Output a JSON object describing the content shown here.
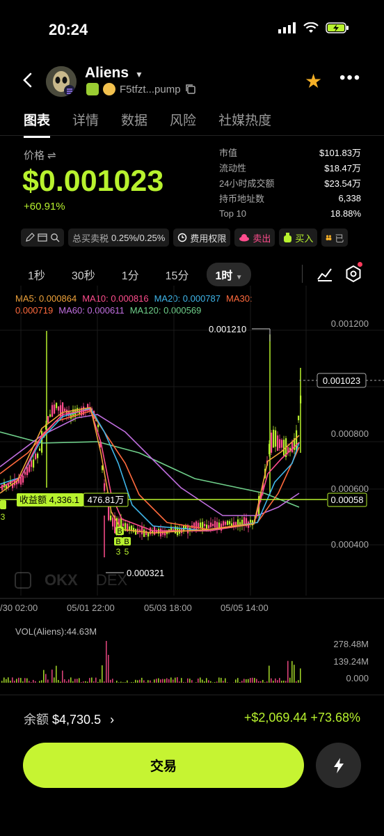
{
  "status_bar": {
    "time": "20:24"
  },
  "header": {
    "token_name": "Aliens",
    "address": "F5tfzt...pump"
  },
  "tabs": [
    {
      "label": "图表",
      "active": true
    },
    {
      "label": "详情",
      "active": false
    },
    {
      "label": "数据",
      "active": false
    },
    {
      "label": "风险",
      "active": false
    },
    {
      "label": "社媒热度",
      "active": false
    }
  ],
  "price": {
    "label": "价格 ⇌",
    "value": "$0.001023",
    "change": "+60.91%"
  },
  "stats": [
    {
      "key": "市值",
      "value": "$101.83万"
    },
    {
      "key": "流动性",
      "value": "$18.47万"
    },
    {
      "key": "24小时成交额",
      "value": "$23.54万"
    },
    {
      "key": "持币地址数",
      "value": "6,338"
    },
    {
      "key": "Top 10",
      "value": "18.88%"
    }
  ],
  "chips": {
    "tax_label": "总买卖税",
    "tax_value": "0.25%/0.25%",
    "fee_label": "费用权限",
    "sell_label": "卖出",
    "buy_label": "买入",
    "partial_label": "已"
  },
  "intervals": [
    {
      "label": "1秒",
      "active": false
    },
    {
      "label": "30秒",
      "active": false
    },
    {
      "label": "1分",
      "active": false
    },
    {
      "label": "15分",
      "active": false
    },
    {
      "label": "1时",
      "active": true
    }
  ],
  "ma_legend": [
    {
      "text": "MA5: 0.000864",
      "color": "#f0a33a"
    },
    {
      "text": "MA10: 0.000816",
      "color": "#ff4d8d"
    },
    {
      "text": "MA20: 0.000787",
      "color": "#3fb6ea"
    },
    {
      "text": "MA30: 0.000719",
      "color": "#ff6a3d"
    },
    {
      "text": "MA60: 0.000611",
      "color": "#c16fe0"
    },
    {
      "text": "MA120: 0.000569",
      "color": "#6fcf8a"
    }
  ],
  "chart_data": {
    "type": "candlestick",
    "y_ticks": [
      "0.001200",
      "0.000800",
      "0.000600",
      "0.000400"
    ],
    "x_ticks": [
      "/30 02:00",
      "05/01 22:00",
      "05/03 18:00",
      "05/05 14:00"
    ],
    "current_price": "0.001023",
    "high_label": "0.001210",
    "low_label": "0.000321",
    "position_line_value": "0.00058",
    "position_label": "收益额 4,336.1",
    "position_amount": "476.81万",
    "markers": [
      "B",
      "B",
      "B",
      "3",
      "5",
      "3"
    ],
    "watermark": "DEX",
    "volume_label": "VOL(Aliens):44.63M",
    "volume_ticks": [
      "278.48M",
      "139.24M",
      "0.000"
    ]
  },
  "footer": {
    "balance_label": "余额",
    "balance_value": "$4,730.5",
    "pnl": "+$2,069.44 +73.68%",
    "trade_label": "交易"
  },
  "colors": {
    "accent": "#c6f432",
    "up": "#b8f22e",
    "down": "#ff4d8d",
    "star": "#f5b027"
  }
}
